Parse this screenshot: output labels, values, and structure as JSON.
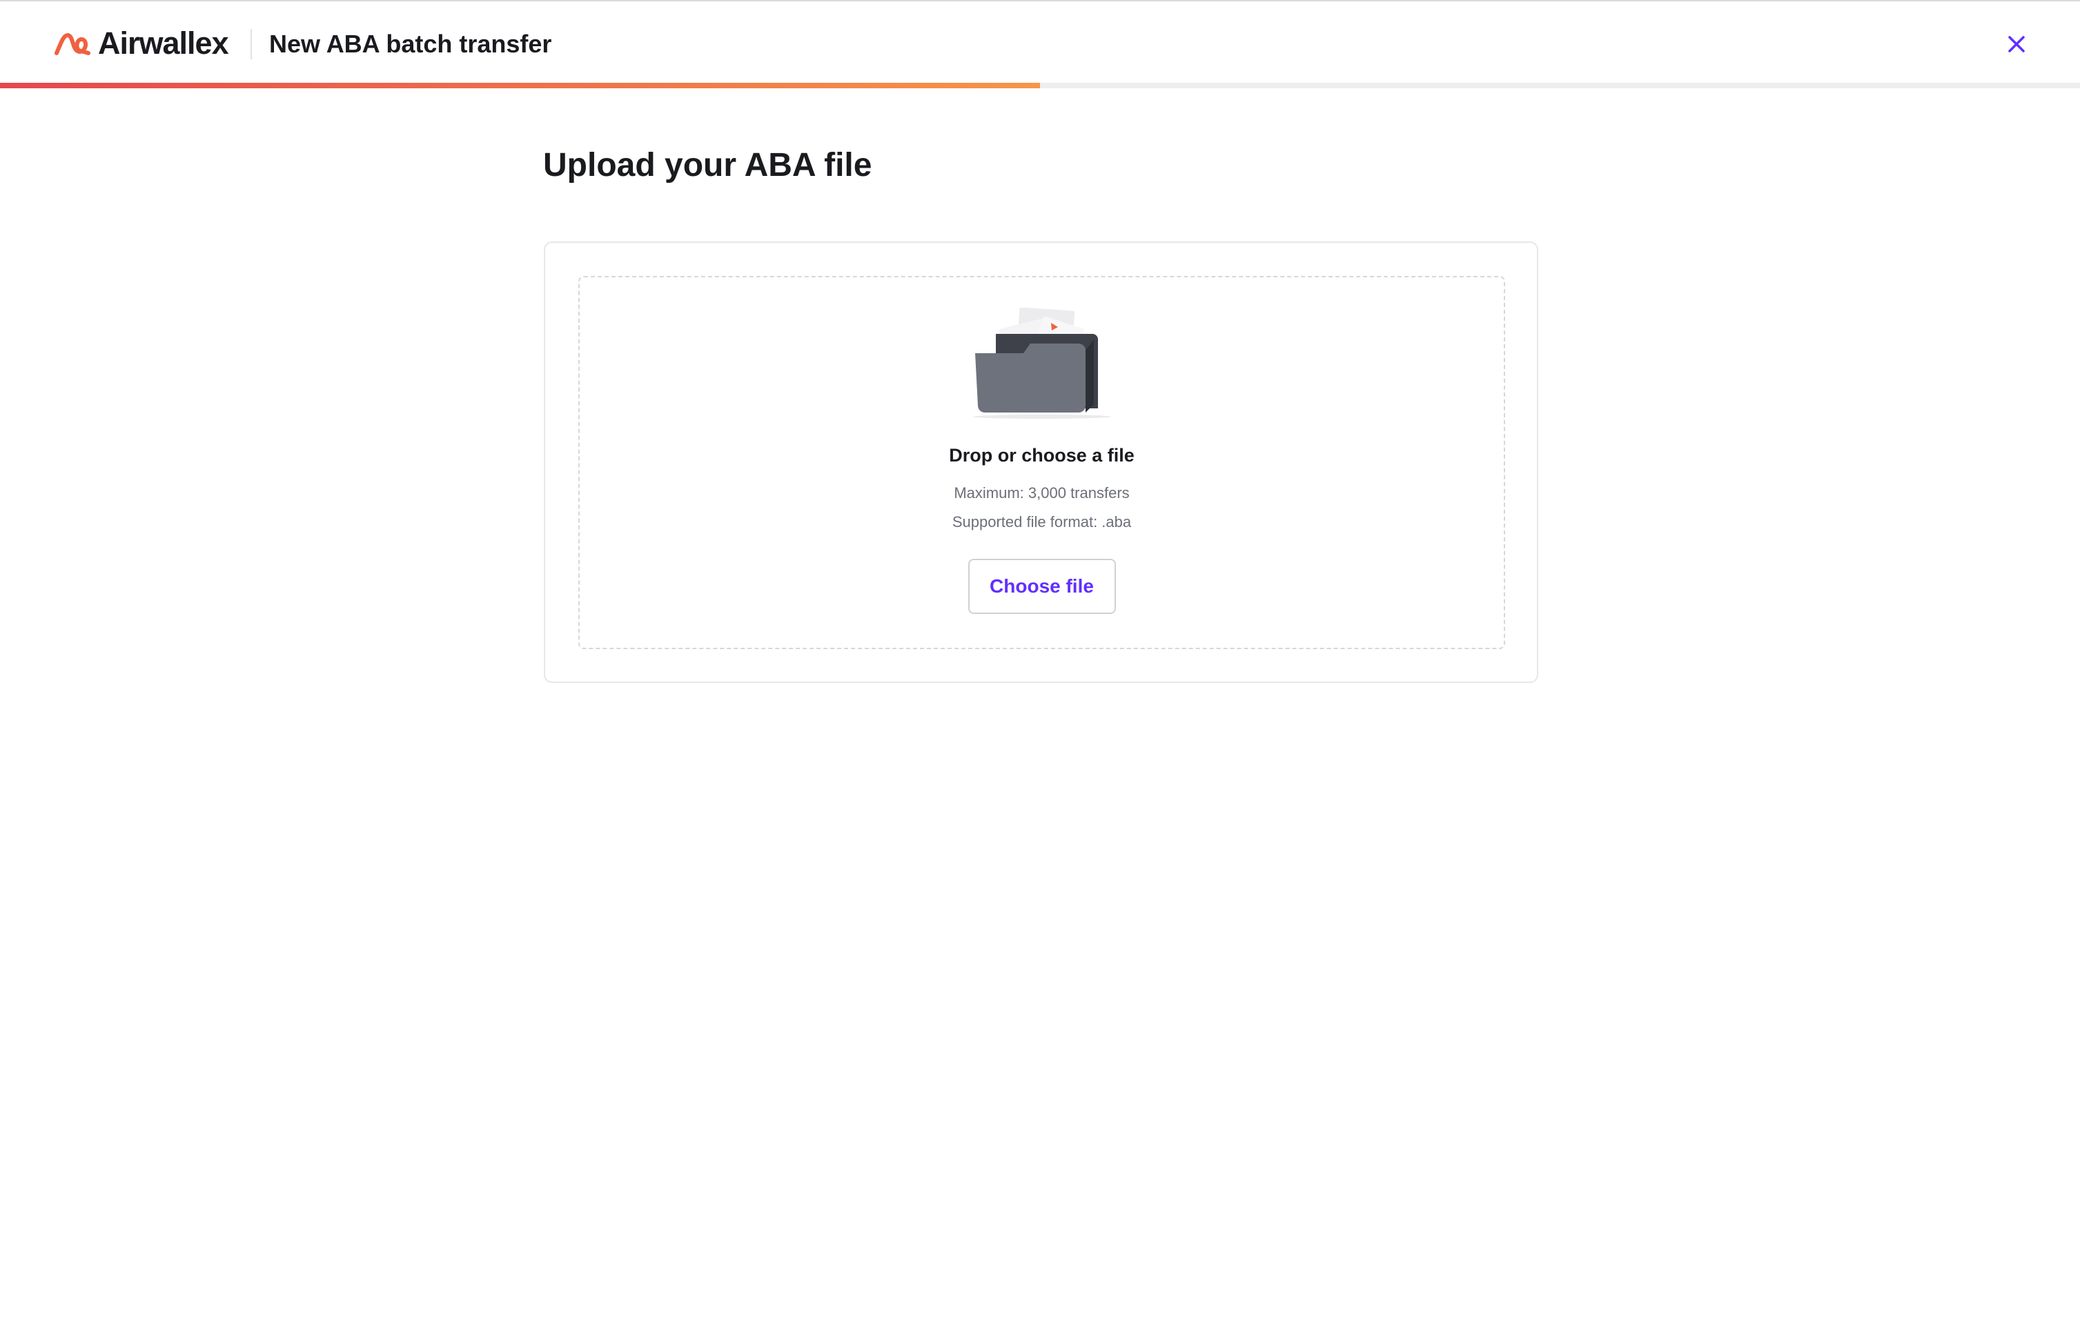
{
  "app": {
    "brand_name": "Airwallex",
    "brand_color": "#f06140",
    "accent_color": "#612fff"
  },
  "header": {
    "title": "New ABA batch transfer",
    "close_icon": "close-icon"
  },
  "progress": {
    "fraction": 0.5,
    "gradient_start": "#e5484d",
    "gradient_end": "#f5964a"
  },
  "main": {
    "title": "Upload your ABA file"
  },
  "upload": {
    "illustration": "folder-icon",
    "title": "Drop or choose a file",
    "max_text": "Maximum: 3,000 transfers",
    "format_text": "Supported file format: .aba",
    "button_label": "Choose file"
  }
}
